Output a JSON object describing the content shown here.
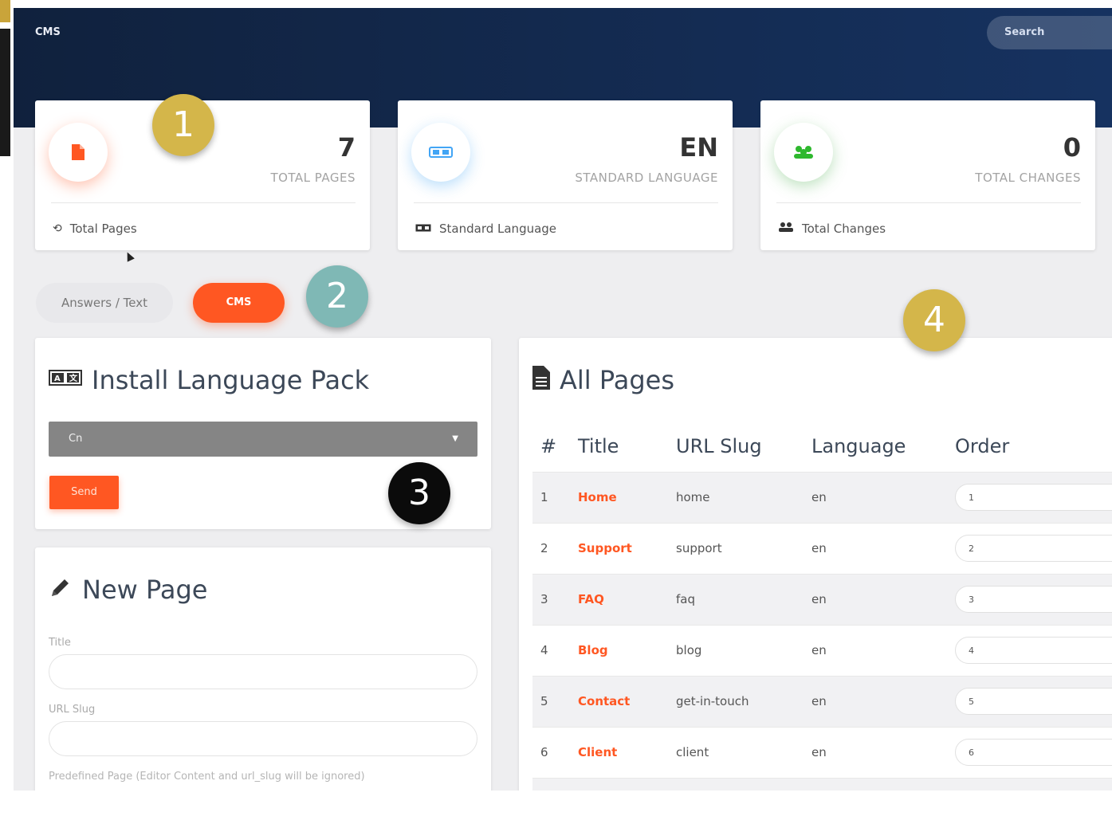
{
  "header": {
    "brand": "CMS",
    "search_placeholder": "Search"
  },
  "stats": [
    {
      "value": "7",
      "label": "TOTAL PAGES",
      "footer": "Total Pages",
      "icon": "file-icon",
      "footer_icon": "history-icon",
      "color": "#ff5722"
    },
    {
      "value": "EN",
      "label": "STANDARD LANGUAGE",
      "footer": "Standard Language",
      "icon": "language-icon",
      "footer_icon": "language-icon",
      "color": "#42a5f5"
    },
    {
      "value": "0",
      "label": "TOTAL CHANGES",
      "footer": "Total Changes",
      "icon": "users-icon",
      "footer_icon": "users-icon",
      "color": "#2eb82e"
    }
  ],
  "tabs": [
    {
      "label": "Answers / Text",
      "active": false
    },
    {
      "label": "CMS",
      "active": true
    }
  ],
  "install_panel": {
    "title": "Install Language Pack",
    "selected_value": "Cn",
    "send_label": "Send"
  },
  "new_page_panel": {
    "title": "New Page",
    "fields": [
      {
        "label": "Title",
        "value": ""
      },
      {
        "label": "URL Slug",
        "value": ""
      }
    ],
    "hint": "Predefined Page (Editor Content and url_slug will be ignored)"
  },
  "pages_panel": {
    "title": "All Pages",
    "columns": [
      "#",
      "Title",
      "URL Slug",
      "Language",
      "Order"
    ],
    "rows": [
      {
        "num": "1",
        "title": "Home",
        "slug": "home",
        "lang": "en",
        "order": "1"
      },
      {
        "num": "2",
        "title": "Support",
        "slug": "support",
        "lang": "en",
        "order": "2"
      },
      {
        "num": "3",
        "title": "FAQ",
        "slug": "faq",
        "lang": "en",
        "order": "3"
      },
      {
        "num": "4",
        "title": "Blog",
        "slug": "blog",
        "lang": "en",
        "order": "4"
      },
      {
        "num": "5",
        "title": "Contact",
        "slug": "get-in-touch",
        "lang": "en",
        "order": "5"
      },
      {
        "num": "6",
        "title": "Client",
        "slug": "client",
        "lang": "en",
        "order": "6"
      }
    ]
  },
  "annotations": [
    "1",
    "2",
    "3",
    "4"
  ],
  "colors": {
    "accent": "#ff5722",
    "header": "#10213d",
    "badge_gold": "#d4b64a",
    "badge_teal": "#7fb8b5",
    "badge_black": "#0b0b0b"
  }
}
